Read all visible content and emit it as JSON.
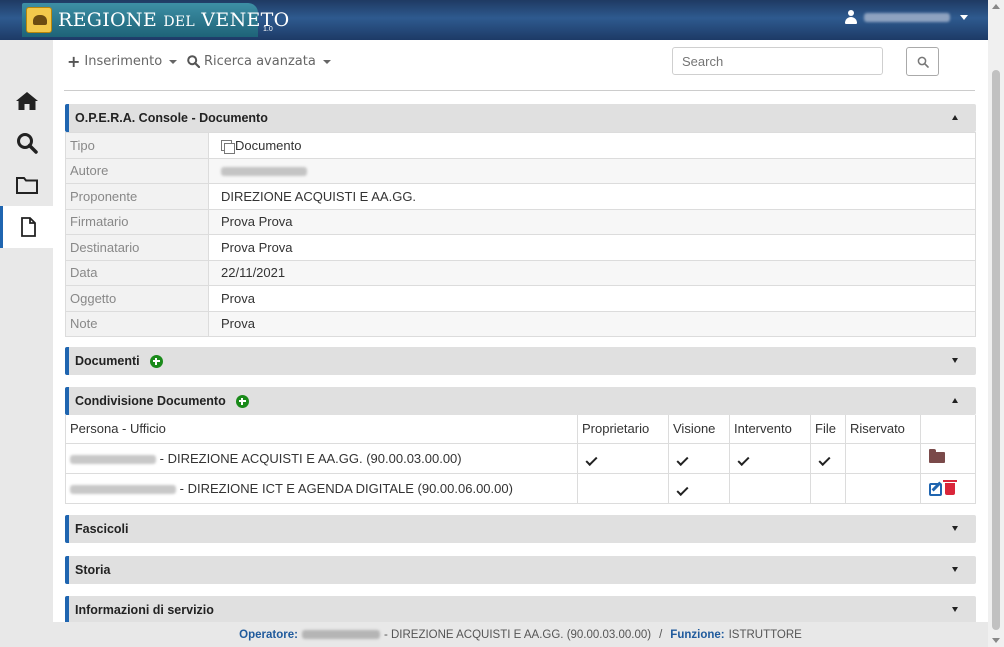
{
  "header": {
    "brand_main": "REGIONE",
    "brand_del": "DEL",
    "brand_end": "VENETO",
    "version": "1.0",
    "user_icon": "user-icon"
  },
  "sidebar": {
    "items": [
      {
        "name": "home",
        "icon": "home-icon"
      },
      {
        "name": "search",
        "icon": "search-icon"
      },
      {
        "name": "folder",
        "icon": "folder-icon"
      },
      {
        "name": "document",
        "icon": "file-icon",
        "active": true
      }
    ]
  },
  "toolbar": {
    "insert_label": "Inserimento",
    "advanced_search_label": "Ricerca avanzata",
    "search_placeholder": "Search"
  },
  "document_panel": {
    "title": "O.P.E.R.A. Console - Documento",
    "rows": [
      {
        "label": "Tipo",
        "value": "Documento"
      },
      {
        "label": "Autore",
        "value": ""
      },
      {
        "label": "Proponente",
        "value": "DIREZIONE ACQUISTI E AA.GG."
      },
      {
        "label": "Firmatario",
        "value": "Prova Prova"
      },
      {
        "label": "Destinatario",
        "value": "Prova Prova"
      },
      {
        "label": "Data",
        "value": "22/11/2021"
      },
      {
        "label": "Oggetto",
        "value": "Prova"
      },
      {
        "label": "Note",
        "value": "Prova"
      }
    ]
  },
  "documents_panel": {
    "title": "Documenti"
  },
  "sharing_panel": {
    "title": "Condivisione Documento",
    "columns": [
      "Persona - Ufficio",
      "Proprietario",
      "Visione",
      "Intervento",
      "File",
      "Riservato"
    ],
    "rows": [
      {
        "office": "- DIREZIONE ACQUISTI E AA.GG.  (90.00.03.00.00)",
        "proprietario": true,
        "visione": true,
        "intervento": true,
        "file": true,
        "riservato": false
      },
      {
        "office": "- DIREZIONE ICT E AGENDA DIGITALE  (90.00.06.00.00)",
        "proprietario": false,
        "visione": true,
        "intervento": false,
        "file": false,
        "riservato": false
      }
    ]
  },
  "fascicoli_panel": {
    "title": "Fascicoli"
  },
  "storia_panel": {
    "title": "Storia"
  },
  "info_panel": {
    "title": "Informazioni di servizio"
  },
  "footer": {
    "operator_label": "Operatore:",
    "operator_office": "- DIREZIONE ACQUISTI E AA.GG. (90.00.03.00.00)",
    "separator": "/",
    "function_label": "Funzione:",
    "function_value": "ISTRUTTORE"
  },
  "colors": {
    "accent": "#1f65b0",
    "header": "#1f3a63",
    "add": "#1a8a1a",
    "delete": "#d9263a"
  }
}
